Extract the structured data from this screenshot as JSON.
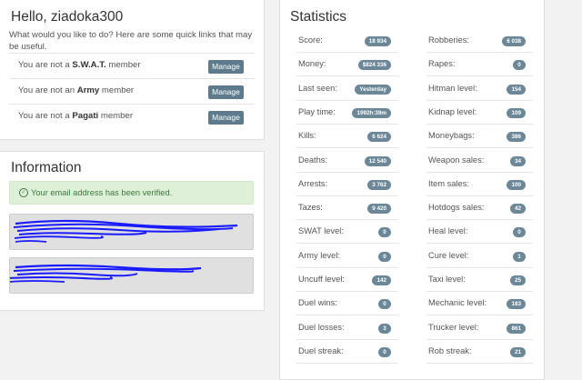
{
  "hello": {
    "title": "Hello, ziadoka300",
    "intro": "What would you like to do? Here are some quick links that may be useful.",
    "members": [
      {
        "prefix": "You are not a ",
        "group": "S.W.A.T.",
        "suffix": " member",
        "button": "Manage"
      },
      {
        "prefix": "You are not an ",
        "group": "Army",
        "suffix": " member",
        "button": "Manage"
      },
      {
        "prefix": "You are not a ",
        "group": "Pagati",
        "suffix": " member",
        "button": "Manage"
      }
    ]
  },
  "information": {
    "title": "Information",
    "alert": "Your email address has been verified."
  },
  "statistics": {
    "title": "Statistics",
    "left": [
      {
        "label": "Score:",
        "value": "18 934"
      },
      {
        "label": "Money:",
        "value": "$824 336"
      },
      {
        "label": "Last seen:",
        "value": "Yesterday"
      },
      {
        "label": "Play time:",
        "value": "1992h:39m"
      },
      {
        "label": "Kills:",
        "value": "6 624"
      },
      {
        "label": "Deaths:",
        "value": "12 540"
      },
      {
        "label": "Arrests:",
        "value": "3 762"
      },
      {
        "label": "Tazes:",
        "value": "9 420"
      },
      {
        "label": "SWAT level:",
        "value": "0"
      },
      {
        "label": "Army level:",
        "value": "0"
      },
      {
        "label": "Uncuff level:",
        "value": "142"
      },
      {
        "label": "Duel wins:",
        "value": "0"
      },
      {
        "label": "Duel losses:",
        "value": "3"
      },
      {
        "label": "Duel streak:",
        "value": "0"
      }
    ],
    "right": [
      {
        "label": "Robberies:",
        "value": "6 038"
      },
      {
        "label": "Rapes:",
        "value": "0"
      },
      {
        "label": "Hitman level:",
        "value": "154"
      },
      {
        "label": "Kidnap level:",
        "value": "109"
      },
      {
        "label": "Moneybags:",
        "value": "386"
      },
      {
        "label": "Weapon sales:",
        "value": "34"
      },
      {
        "label": "Item sales:",
        "value": "100"
      },
      {
        "label": "Hotdogs sales:",
        "value": "42"
      },
      {
        "label": "Heal level:",
        "value": "0"
      },
      {
        "label": "Cure level:",
        "value": "1"
      },
      {
        "label": "Taxi level:",
        "value": "25"
      },
      {
        "label": "Mechanic level:",
        "value": "183"
      },
      {
        "label": "Trucker level:",
        "value": "861"
      },
      {
        "label": "Rob streak:",
        "value": "21"
      }
    ]
  }
}
